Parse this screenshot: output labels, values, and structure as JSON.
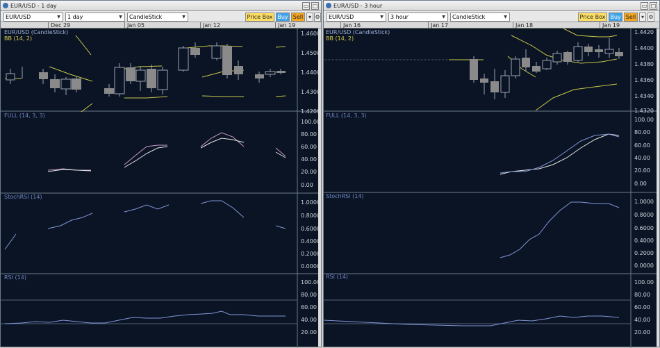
{
  "left": {
    "title": "EUR/USD - 1 day",
    "symbol": "EUR/USD",
    "interval": "1 day",
    "chart_style": "CandleStick",
    "price_box": "Price Box",
    "buy": "Buy",
    "sell": "Sell",
    "dates": [
      "Dec 29",
      "Jan 05",
      "Jan 12",
      "Jan 19"
    ],
    "panels": {
      "price": {
        "label": "EUR/USD (CandleStick)",
        "sub": "BB (14, 2)",
        "ticks": [
          "1.4600",
          "1.4500",
          "1.4400",
          "1.4300",
          "1.4200"
        ]
      },
      "full": {
        "label": "FULL (14, 3, 3)",
        "ticks": [
          "100.00",
          "80.00",
          "60.00",
          "40.00",
          "20.00",
          "0.00"
        ]
      },
      "stochrsi": {
        "label": "StochRSI (14)",
        "ticks": [
          "1.0000",
          "0.8000",
          "0.6000",
          "0.4000",
          "0.2000",
          "0.0000"
        ]
      },
      "rsi": {
        "label": "RSI (14)",
        "ticks": [
          "100.00",
          "80.00",
          "60.00",
          "40.00",
          "20.00"
        ]
      }
    }
  },
  "right": {
    "title": "EUR/USD - 3 hour",
    "symbol": "EUR/USD",
    "interval": "3 hour",
    "chart_style": "CandleStick",
    "price_box": "Price Box",
    "buy": "Buy",
    "sell": "Sell",
    "dates": [
      "Jan 16",
      "Jan 17",
      "Jan 18",
      "Jan 19"
    ],
    "panels": {
      "price": {
        "label": "EUR/USD (CandleStick)",
        "sub": "BB (14, 2)",
        "ticks": [
          "1.4420",
          "1.4400",
          "1.4380",
          "1.4360",
          "1.4340",
          "1.4320"
        ]
      },
      "full": {
        "label": "FULL (14, 3, 3)",
        "ticks": [
          "100.00",
          "80.00",
          "60.00",
          "40.00",
          "20.00",
          "0.00"
        ]
      },
      "stochrsi": {
        "label": "StochRSI (14)",
        "ticks": [
          "1.0000",
          "0.8000",
          "0.6000",
          "0.4000",
          "0.2000",
          "0.0000"
        ]
      },
      "rsi": {
        "label": "RSI (14)",
        "ticks": [
          "100.00",
          "80.00",
          "60.00",
          "40.00",
          "20.00"
        ]
      }
    }
  },
  "colors": {
    "bg": "#0b1424",
    "grid": "#2b3a55",
    "axis_text": "#cfd6e0",
    "label_blue": "#6f86c9",
    "label_yellow": "#d9c94c",
    "candle_up": "#0b1424",
    "candle_down": "#8a8a8a",
    "bb": "#c8c84a",
    "line_white": "#e6e6e6",
    "line_pink": "#c69bc6",
    "line_blue": "#7f96d8"
  }
}
